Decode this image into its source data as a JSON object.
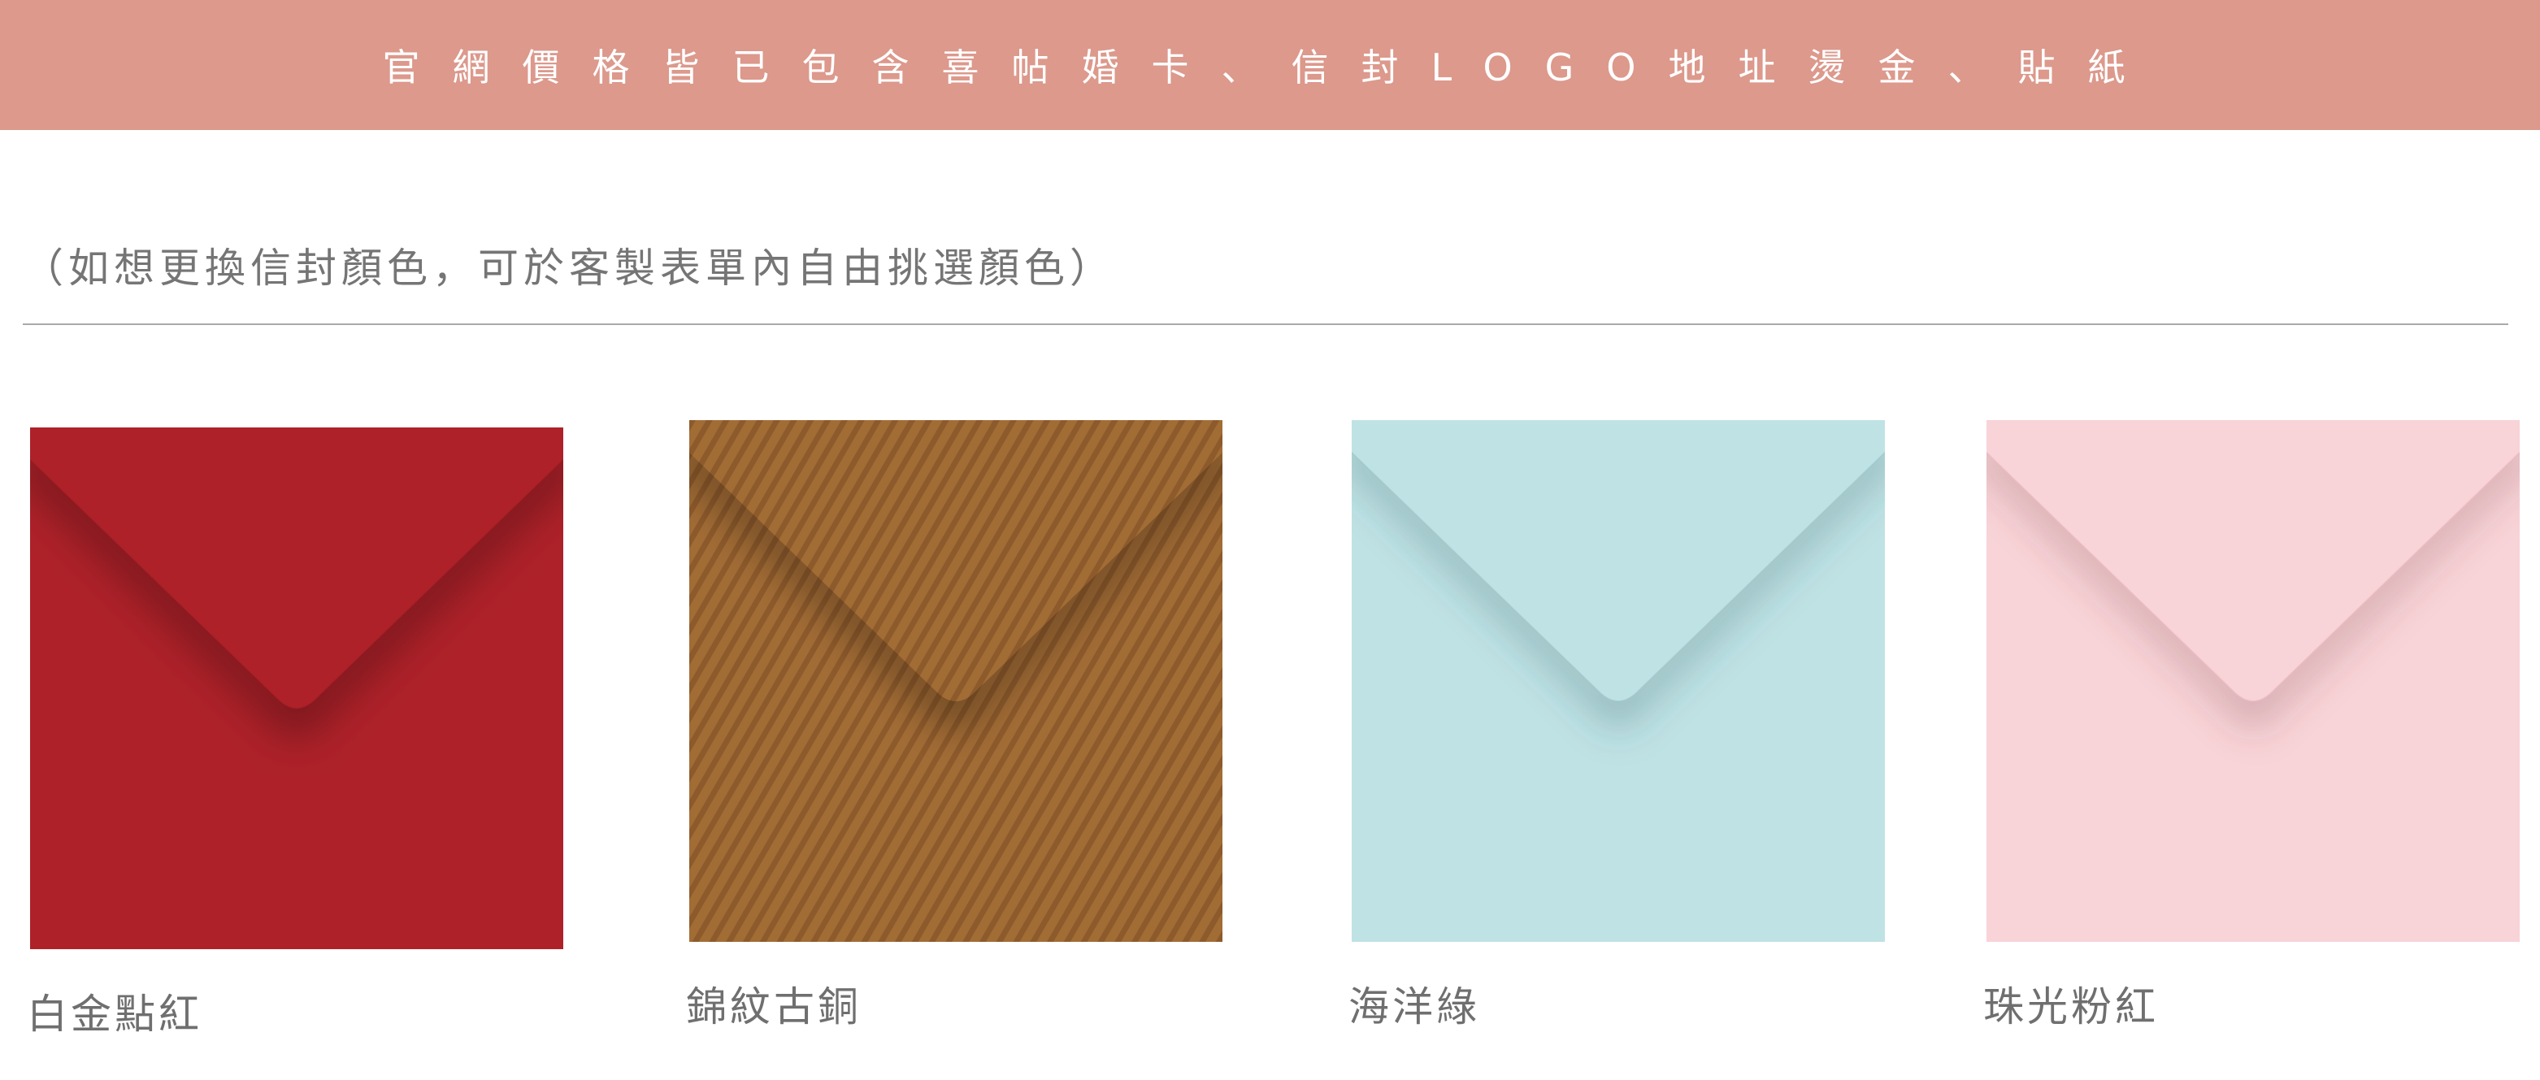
{
  "banner": {
    "text": "官網價格皆已包含喜帖婚卡、信封LOGO地址燙金、貼紙",
    "background": "#dc998c"
  },
  "note": "（如想更換信封顏色，可於客製表單內自由挑選顏色）",
  "envelopes": [
    {
      "name": "白金點紅",
      "color": "#ae2129",
      "pattern": "solid"
    },
    {
      "name": "錦紋古銅",
      "color": "#a26c35",
      "pattern": "diagonal-stripes"
    },
    {
      "name": "海洋綠",
      "color": "#bfe2e5",
      "pattern": "solid"
    },
    {
      "name": "珠光粉紅",
      "color": "#f8d3d7",
      "pattern": "solid"
    }
  ]
}
